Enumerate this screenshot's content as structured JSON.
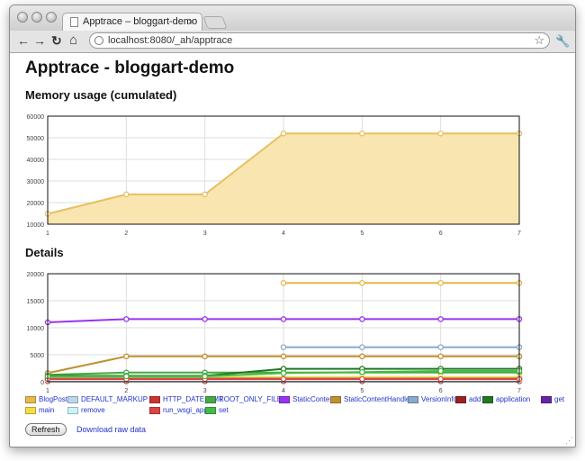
{
  "browser": {
    "tab_title": "Apptrace – bloggart-demo",
    "tab_close": "✕",
    "url": "localhost:8080/_ah/apptrace",
    "back_icon": "←",
    "forward_icon": "→",
    "reload_icon": "↻",
    "home_icon": "⌂",
    "star_icon": "☆",
    "wrench_icon": "🔧"
  },
  "page": {
    "title": "Apptrace - bloggart-demo",
    "memory_heading": "Memory usage (cumulated)",
    "details_heading": "Details",
    "refresh_label": "Refresh",
    "download_label": "Download raw data"
  },
  "chart_data": [
    {
      "type": "area",
      "x": [
        1,
        2,
        3,
        4,
        5,
        6,
        7
      ],
      "ylim": [
        10000,
        60000
      ],
      "yticks": [
        "60000",
        "50000",
        "40000",
        "30000",
        "20000",
        "10000"
      ],
      "xticks": [
        "1",
        "2",
        "3",
        "4",
        "5",
        "6",
        "7"
      ],
      "grid": true,
      "series": [
        {
          "values": [
            14800,
            23800,
            23800,
            52000,
            52000,
            52000,
            52000
          ],
          "color": "#e8c060",
          "fill": "#f8e5b0"
        }
      ]
    },
    {
      "type": "line",
      "x": [
        1,
        2,
        3,
        4,
        5,
        6,
        7
      ],
      "ylim": [
        0,
        20000
      ],
      "yticks": [
        "20000",
        "15000",
        "10000",
        "5000",
        "0"
      ],
      "xticks": [
        "1",
        "2",
        "3",
        "4",
        "5",
        "6",
        "7"
      ],
      "grid": true,
      "legend": "bottom",
      "series": [
        {
          "name": "BlogPost",
          "color": "#e7b84a",
          "values": [
            null,
            null,
            null,
            18300,
            18300,
            18300,
            18300
          ]
        },
        {
          "name": "DEFAULT_MARKUP",
          "color": "#bcd6f0",
          "values": [
            200,
            200,
            200,
            200,
            200,
            200,
            200
          ]
        },
        {
          "name": "HTTP_DATE_FMT",
          "color": "#cc3333",
          "values": [
            100,
            100,
            100,
            100,
            100,
            100,
            100
          ]
        },
        {
          "name": "ROOT_ONLY_FILES",
          "color": "#44aa44",
          "values": [
            1300,
            1700,
            1700,
            1700,
            1700,
            1700,
            1700
          ]
        },
        {
          "name": "StaticContent",
          "color": "#9933ee",
          "values": [
            11000,
            11600,
            11600,
            11600,
            11600,
            11600,
            11600
          ]
        },
        {
          "name": "StaticContentHandler",
          "color": "#c09030",
          "values": [
            1600,
            4700,
            4700,
            4700,
            4700,
            4700,
            4700
          ]
        },
        {
          "name": "VersionInfo",
          "color": "#88aacc",
          "values": [
            null,
            null,
            null,
            6400,
            6400,
            6400,
            6400
          ]
        },
        {
          "name": "add",
          "color": "#992222",
          "values": [
            400,
            400,
            400,
            400,
            400,
            400,
            400
          ]
        },
        {
          "name": "application",
          "color": "#227722",
          "values": [
            1100,
            1100,
            1100,
            2400,
            2400,
            2400,
            2400
          ]
        },
        {
          "name": "get",
          "color": "#6622aa",
          "values": [
            700,
            700,
            700,
            700,
            700,
            700,
            700
          ]
        },
        {
          "name": "main",
          "color": "#f4dd44",
          "values": [
            900,
            900,
            900,
            900,
            900,
            900,
            900
          ]
        },
        {
          "name": "remove",
          "color": "#ccf4f8",
          "values": [
            300,
            300,
            300,
            300,
            300,
            300,
            300
          ]
        },
        {
          "name": "run_wsgi_app",
          "color": "#dd4444",
          "values": [
            500,
            500,
            500,
            500,
            500,
            500,
            500
          ]
        },
        {
          "name": "set",
          "color": "#44bb44",
          "values": [
            1000,
            1000,
            1000,
            1600,
            1800,
            2000,
            2000
          ]
        }
      ]
    }
  ]
}
